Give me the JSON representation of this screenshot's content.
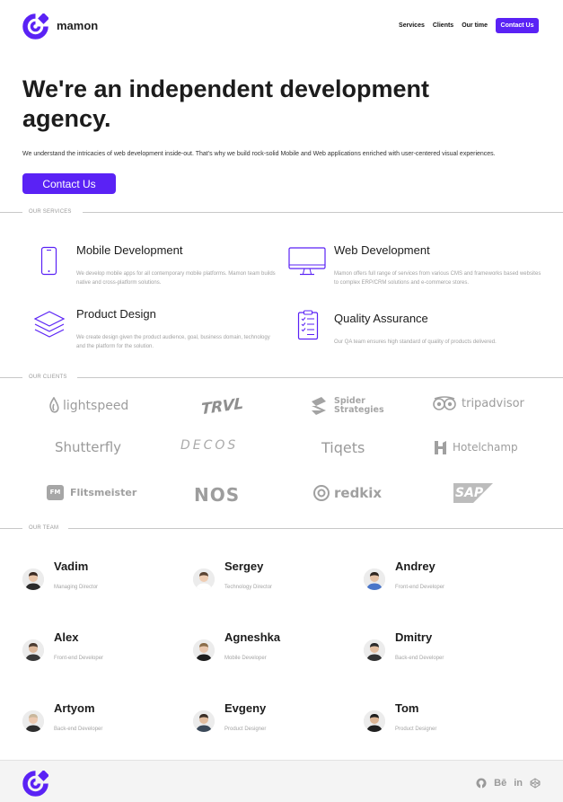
{
  "header": {
    "brand": "mamon",
    "nav": [
      "Services",
      "Clients",
      "Our time"
    ],
    "cta": "Contact Us"
  },
  "hero": {
    "title": "We're an independent development agency.",
    "text": "We understand the intricacies of web development inside-out. That's why we build rock-solid Mobile and Web applications enriched with user-centered visual experiences.",
    "button": "Contact Us"
  },
  "sections": {
    "services": "OUR SERVICES",
    "clients": "OUR CLIENTS",
    "team": "OUR TEAM"
  },
  "services": [
    {
      "title": "Mobile Development",
      "icon": "mobile-phone-icon",
      "desc": "We develop mobile apps for all contemporary mobile platforms. Mamon team builds native and cross-platform solutions."
    },
    {
      "title": "Web Development",
      "icon": "monitor-icon",
      "desc": "Mamon offers full range of services from various CMS and frameworks based websites to complex ERP/CRM solutions and e-commerce stores."
    },
    {
      "title": "Product Design",
      "icon": "layers-icon",
      "desc": "We create design given the product audience, goal, business domain, technology and the platform for the solution."
    },
    {
      "title": "Quality Assurance",
      "icon": "checklist-icon",
      "desc": "Our QA team ensures high standard of quality of products delivered."
    }
  ],
  "clients": [
    {
      "name": "lightspeed",
      "icon": "lightspeed-flame-icon"
    },
    {
      "name": "TRVL",
      "icon": "trvl-logo"
    },
    {
      "name": "Spider Strategies",
      "line1": "Spider",
      "line2": "Strategies",
      "icon": "spider-strategies-logo-icon"
    },
    {
      "name": "tripadvisor",
      "icon": "tripadvisor-owl-icon"
    },
    {
      "name": "Shutterfly",
      "icon": "shutterfly-logo"
    },
    {
      "name": "DECOS",
      "icon": "decos-logo"
    },
    {
      "name": "Tiqets",
      "icon": "tiqets-logo"
    },
    {
      "name": "Hotelchamp",
      "icon": "hotelchamp-h-icon"
    },
    {
      "name": "Flitsmeister",
      "badge": "FM",
      "icon": "flitsmeister-badge-icon"
    },
    {
      "name": "NOS",
      "icon": "nos-logo"
    },
    {
      "name": "redkix",
      "icon": "redkix-logo-icon"
    },
    {
      "name": "SAP",
      "icon": "sap-logo"
    }
  ],
  "team": [
    {
      "name": "Vadim",
      "role": "Managing Director"
    },
    {
      "name": "Sergey",
      "role": "Technology Director"
    },
    {
      "name": "Andrey",
      "role": "Front-end Developer"
    },
    {
      "name": "Alex",
      "role": "Front-end Developer"
    },
    {
      "name": "Agneshka",
      "role": "Mobile Developer"
    },
    {
      "name": "Dmitry",
      "role": "Back-end Developer"
    },
    {
      "name": "Artyom",
      "role": "Back-end Developer"
    },
    {
      "name": "Evgeny",
      "role": "Product Designer"
    },
    {
      "name": "Tom",
      "role": "Product Designer"
    }
  ],
  "footer": {
    "socials": [
      {
        "name": "github",
        "icon": "github-icon"
      },
      {
        "name": "Bē",
        "icon": "behance-icon"
      },
      {
        "name": "in",
        "icon": "linkedin-icon"
      },
      {
        "name": "codepen",
        "icon": "codepen-icon"
      }
    ]
  },
  "colors": {
    "accent": "#5a22f5",
    "text": "#1c1c1c",
    "muted": "#a2a2a2",
    "footer_bg": "#f4f4f4"
  }
}
